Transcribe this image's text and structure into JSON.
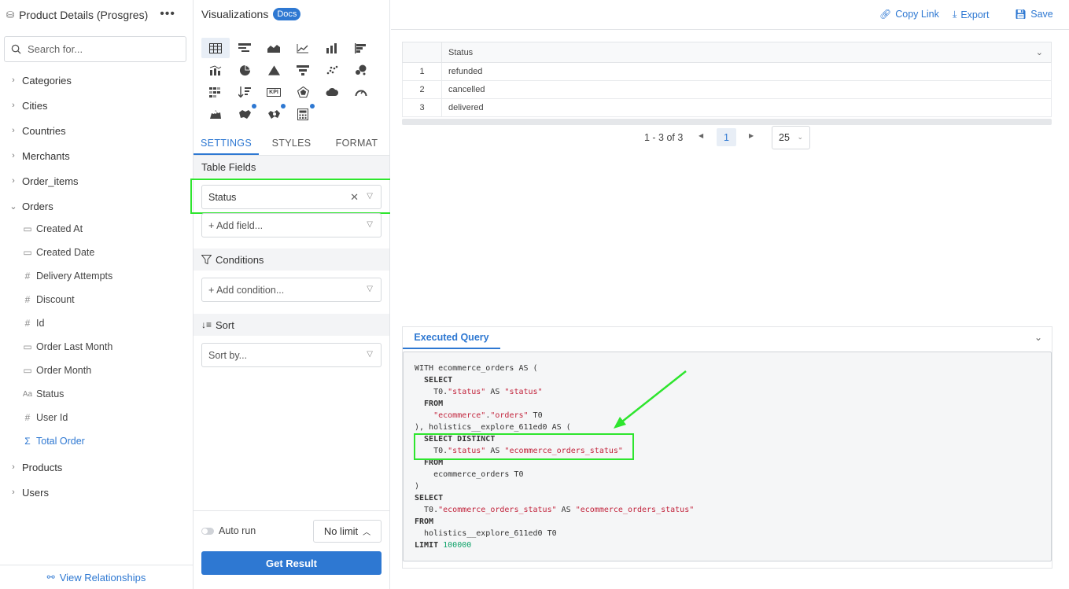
{
  "sidebar": {
    "title": "Product Details (Prosgres)",
    "search_placeholder": "Search for...",
    "groups": [
      {
        "label": "Categories"
      },
      {
        "label": "Cities"
      },
      {
        "label": "Countries"
      },
      {
        "label": "Merchants"
      },
      {
        "label": "Order_items"
      },
      {
        "label": "Orders"
      },
      {
        "label": "Products"
      },
      {
        "label": "Users"
      }
    ],
    "order_fields": [
      {
        "label": "Created At",
        "icon": "calendar-icon"
      },
      {
        "label": "Created Date",
        "icon": "calendar-icon"
      },
      {
        "label": "Delivery Attempts",
        "icon": "hash-icon"
      },
      {
        "label": "Discount",
        "icon": "hash-icon"
      },
      {
        "label": "Id",
        "icon": "hash-icon"
      },
      {
        "label": "Order Last Month",
        "icon": "calendar-icon"
      },
      {
        "label": "Order Month",
        "icon": "calendar-icon"
      },
      {
        "label": "Status",
        "icon": "text-type-icon"
      },
      {
        "label": "User Id",
        "icon": "hash-icon"
      },
      {
        "label": "Total Order",
        "icon": "sigma-icon"
      }
    ],
    "footer_link": "View Relationships"
  },
  "viz": {
    "title": "Visualizations",
    "badge": "Docs",
    "kpi_label": "KPI",
    "tabs": [
      "SETTINGS",
      "STYLES",
      "FORMAT"
    ],
    "table_fields_heading": "Table Fields",
    "selected_field": "Status",
    "add_field_placeholder": "+ Add field...",
    "conditions_heading": "Conditions",
    "add_condition_placeholder": "+ Add condition...",
    "sort_heading": "Sort",
    "sort_placeholder": "Sort by...",
    "auto_run_label": "Auto run",
    "limit_label": "No limit",
    "get_result_label": "Get Result"
  },
  "toolbar": {
    "copy_link": "Copy Link",
    "export": "Export",
    "save": "Save"
  },
  "results": {
    "column": "Status",
    "rows": [
      {
        "index": "1",
        "value": "refunded"
      },
      {
        "index": "2",
        "value": "cancelled"
      },
      {
        "index": "3",
        "value": "delivered"
      }
    ],
    "range_text": "1 - 3 of 3",
    "current_page": "1",
    "page_size": "25"
  },
  "query": {
    "tab_label": "Executed Query"
  },
  "colors": {
    "accent": "#2e78d2",
    "highlight": "#2ee52e",
    "sql_string": "#c2243c",
    "sql_number": "#11a36b"
  }
}
